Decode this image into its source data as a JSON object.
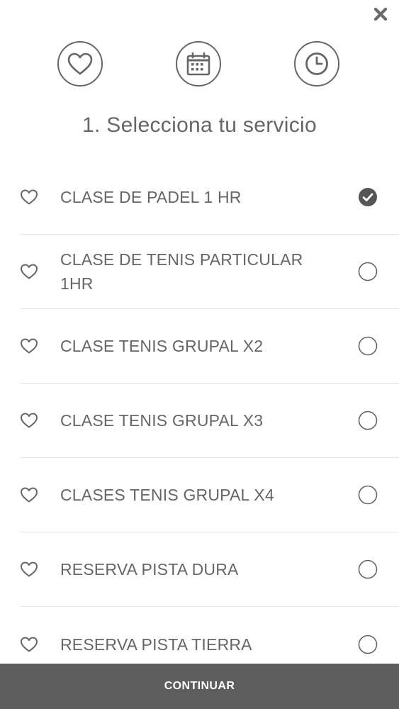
{
  "header": {
    "close_icon": "close-icon",
    "steps": [
      {
        "icon": "heart-icon"
      },
      {
        "icon": "calendar-icon"
      },
      {
        "icon": "clock-icon"
      }
    ]
  },
  "title": "1. Selecciona tu servicio",
  "services": [
    {
      "label": "CLASE DE PADEL 1 HR",
      "selected": true
    },
    {
      "label": "CLASE DE TENIS PARTICULAR 1HR",
      "selected": false
    },
    {
      "label": "CLASE TENIS GRUPAL X2",
      "selected": false
    },
    {
      "label": "CLASE TENIS GRUPAL X3",
      "selected": false
    },
    {
      "label": "CLASES TENIS GRUPAL X4",
      "selected": false
    },
    {
      "label": "RESERVA PISTA DURA",
      "selected": false
    },
    {
      "label": "RESERVA PISTA TIERRA",
      "selected": false
    }
  ],
  "footer": {
    "continue_label": "CONTINUAR"
  },
  "colors": {
    "text": "#666666",
    "footer_bg": "#5d5d5d",
    "selected": "#555555",
    "divider": "#e6e6e6"
  }
}
